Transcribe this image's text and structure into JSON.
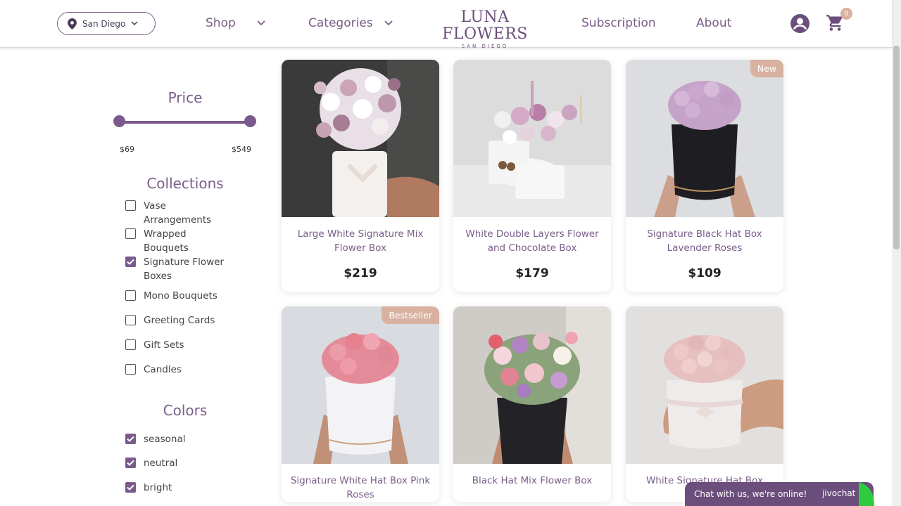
{
  "header": {
    "location": "San Diego",
    "nav": [
      {
        "label": "Shop"
      },
      {
        "label": "Categories"
      },
      {
        "label": "Subscription"
      },
      {
        "label": "About"
      }
    ],
    "logo_main": "LUNA FLOWERS",
    "logo_sub": "SAN DIEGO",
    "cart_count": "0"
  },
  "filters": {
    "price": {
      "title": "Price",
      "min": "$69",
      "max": "$549"
    },
    "collections": {
      "title": "Collections",
      "items": [
        {
          "label": "Vase Arrangements",
          "checked": false
        },
        {
          "label": "Wrapped Bouquets",
          "checked": false
        },
        {
          "label": "Signature Flower Boxes",
          "checked": true
        },
        {
          "label": "Mono Bouquets",
          "checked": false
        },
        {
          "label": "Greeting Cards",
          "checked": false
        },
        {
          "label": "Gift Sets",
          "checked": false
        },
        {
          "label": "Candles",
          "checked": false
        }
      ]
    },
    "colors": {
      "title": "Colors",
      "items": [
        {
          "label": "seasonal",
          "checked": true
        },
        {
          "label": "neutral",
          "checked": true
        },
        {
          "label": "bright",
          "checked": true
        }
      ]
    }
  },
  "products": [
    {
      "name": "Large White Signature Mix Flower Box",
      "price": "$219",
      "tag": ""
    },
    {
      "name": "White Double Layers Flower and Chocolate Box",
      "price": "$179",
      "tag": ""
    },
    {
      "name": "Signature Black Hat Box Lavender Roses",
      "price": "$109",
      "tag": "New"
    },
    {
      "name": "Signature White Hat Box Pink Roses",
      "price": "",
      "tag": "Bestseller"
    },
    {
      "name": "Black Hat Mix Flower Box",
      "price": "",
      "tag": ""
    },
    {
      "name": "White Signature Hat Box",
      "price": "",
      "tag": ""
    }
  ],
  "chat": {
    "text": "Chat with us, we're online!",
    "brand": "jivochat"
  },
  "colors": {
    "accent": "#6b4e7c",
    "tag": "#d8b1a0"
  }
}
